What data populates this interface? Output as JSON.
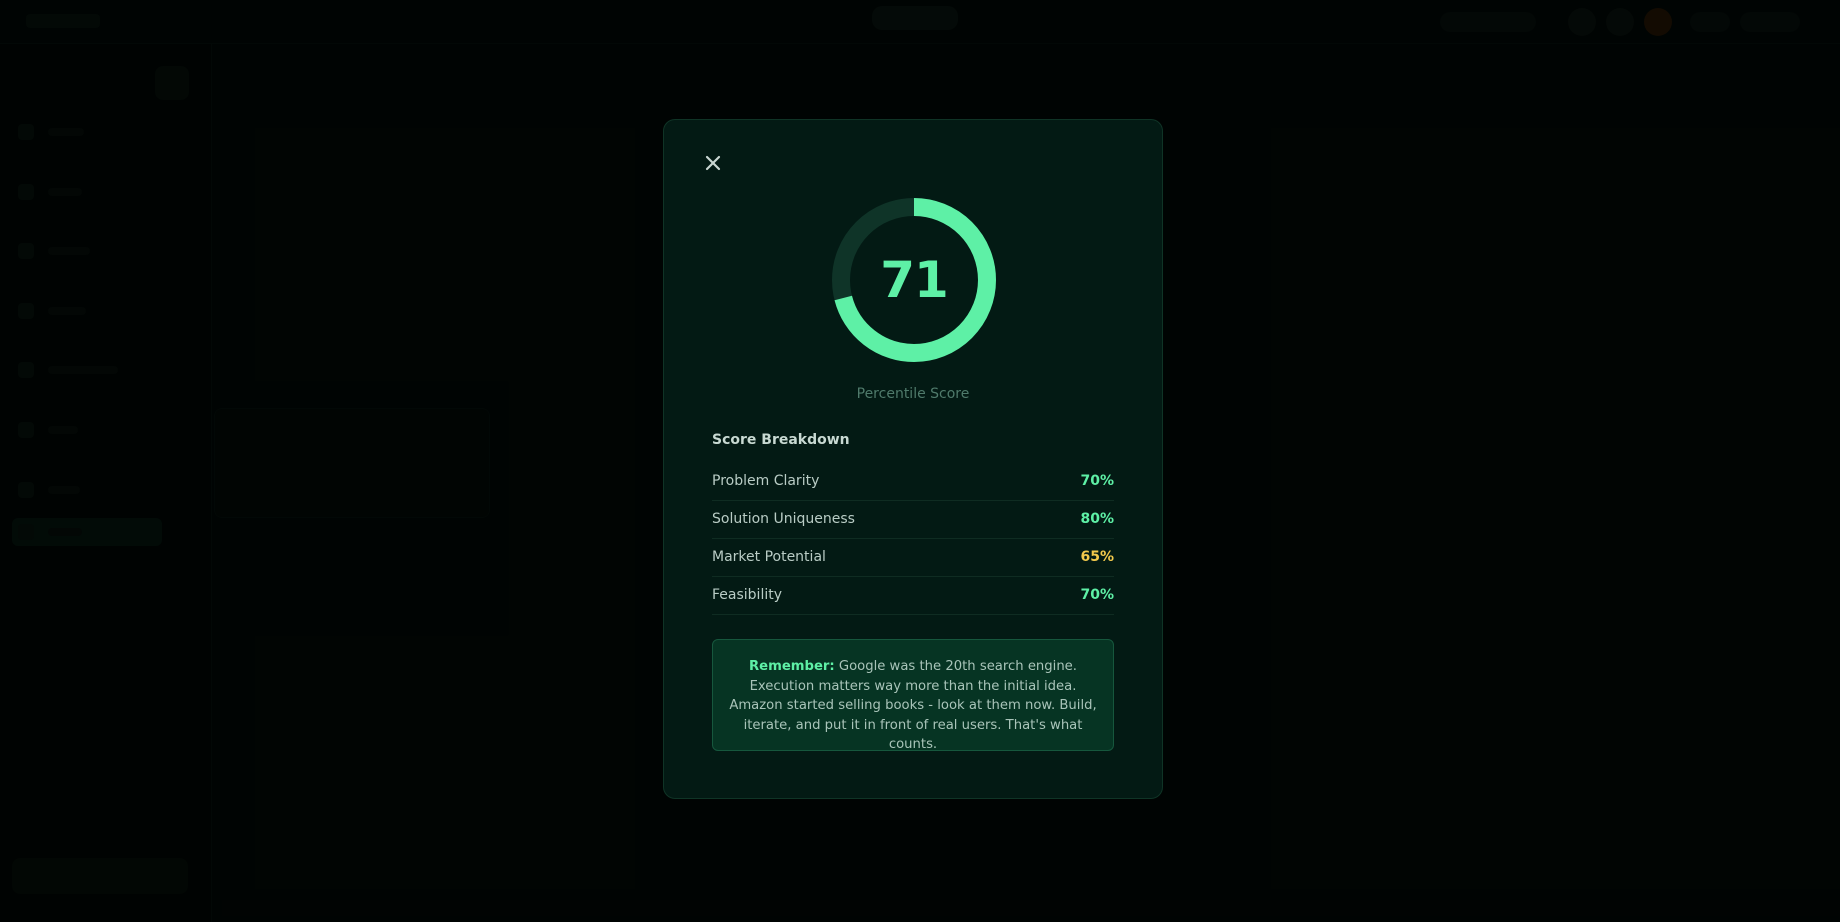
{
  "modal": {
    "score": "71",
    "score_percent": 71,
    "caption": "Percentile Score",
    "breakdown_title": "Score Breakdown",
    "breakdown": [
      {
        "label": "Problem Clarity",
        "value": "70%",
        "color": "#5ef0a6"
      },
      {
        "label": "Solution Uniqueness",
        "value": "80%",
        "color": "#5ef0a6"
      },
      {
        "label": "Market Potential",
        "value": "65%",
        "color": "#f2c94c"
      },
      {
        "label": "Feasibility",
        "value": "70%",
        "color": "#5ef0a6"
      }
    ],
    "tip_prefix": "Remember:",
    "tip_text": " Google was the 20th search engine. Execution matters way more than the initial idea. Amazon started selling books - look at them now. Build, iterate, and put it in front of real users. That's what counts.",
    "close_icon": "close-icon"
  },
  "colors": {
    "accent": "#5ef0a6",
    "warning": "#f2c94c",
    "modal_bg": "#031a14",
    "gauge_track": "#0f3428"
  }
}
